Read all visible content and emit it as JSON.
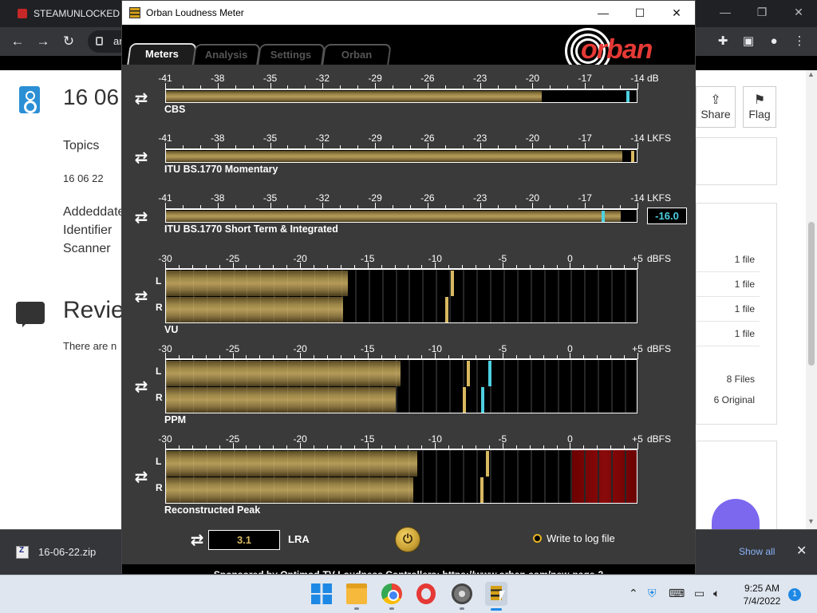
{
  "browser": {
    "tab_title": "STEAMUNLOCKED »",
    "url_fragment": "ar",
    "page": {
      "title": "16 06",
      "topics_label": "Topics",
      "topics_value": "16 06 22",
      "meta_labels": [
        "Addeddate",
        "Identifier",
        "Scanner"
      ],
      "reviews_title": "Revie",
      "reviews_empty": "There are n",
      "share_label": "Share",
      "flag_label": "Flag",
      "file_rows": [
        "1 file",
        "1 file",
        "1 file",
        "1 file"
      ],
      "files_total": "8 Files",
      "files_original": "6 Original"
    },
    "downloads": {
      "file_name": "16-06-22.zip",
      "show_all": "Show all"
    }
  },
  "orban": {
    "window_title": "Orban Loudness Meter",
    "tabs": [
      {
        "label": "Meters",
        "active": true
      },
      {
        "label": "Analysis",
        "active": false
      },
      {
        "label": "Settings",
        "active": false
      },
      {
        "label": "Orban",
        "active": false
      }
    ],
    "logo_text": "orban",
    "meters": [
      {
        "name": "CBS",
        "unit": "dB",
        "scale": [
          "-41",
          "-38",
          "-35",
          "-32",
          "-29",
          "-26",
          "-23",
          "-20",
          "-17",
          "-14"
        ],
        "min": -41,
        "max": -14,
        "channels": [
          {
            "level": -19.5,
            "peak": -14.6,
            "peak_color": "#4dd0e1"
          }
        ]
      },
      {
        "name": "ITU BS.1770 Momentary",
        "unit": "LKFS",
        "scale": [
          "-41",
          "-38",
          "-35",
          "-32",
          "-29",
          "-26",
          "-23",
          "-20",
          "-17",
          "-14"
        ],
        "min": -41,
        "max": -14,
        "channels": [
          {
            "level": -14.9,
            "peak": -14.3,
            "peak_color": "#d8b860"
          }
        ]
      },
      {
        "name": "ITU BS.1770 Short Term & Integrated",
        "unit": "LKFS",
        "scale": [
          "-41",
          "-38",
          "-35",
          "-32",
          "-29",
          "-26",
          "-23",
          "-20",
          "-17",
          "-14"
        ],
        "min": -41,
        "max": -14,
        "channels": [
          {
            "level": -15.0,
            "peak": -16.0,
            "peak_color": "#4dd0e1"
          }
        ],
        "readout": "-16.0"
      },
      {
        "name": "VU",
        "unit": "dBFS",
        "scale": [
          "-30",
          "-25",
          "-20",
          "-15",
          "-10",
          "-5",
          "0",
          "+5"
        ],
        "min": -30,
        "max": 5,
        "labels": [
          "L",
          "R"
        ],
        "channels": [
          {
            "level": -16.5,
            "peak": -8.8,
            "peak_color": "#d8b860"
          },
          {
            "level": -16.9,
            "peak": -9.2,
            "peak_color": "#d8b860"
          }
        ]
      },
      {
        "name": "PPM",
        "unit": "dBFS",
        "scale": [
          "-30",
          "-25",
          "-20",
          "-15",
          "-10",
          "-5",
          "0",
          "+5"
        ],
        "min": -30,
        "max": 5,
        "labels": [
          "L",
          "R"
        ],
        "channels": [
          {
            "level": -12.6,
            "peak": -7.6,
            "peak_color": "#d8b860",
            "peak2": -6.0,
            "peak2_color": "#4dd0e1"
          },
          {
            "level": -13.0,
            "peak": -7.9,
            "peak_color": "#d8b860",
            "peak2": -6.5,
            "peak2_color": "#4dd0e1"
          }
        ]
      },
      {
        "name": "Reconstructed Peak",
        "unit": "dBFS",
        "scale": [
          "-30",
          "-25",
          "-20",
          "-15",
          "-10",
          "-5",
          "0",
          "+5"
        ],
        "min": -30,
        "max": 5,
        "labels": [
          "L",
          "R"
        ],
        "red_from": 0,
        "channels": [
          {
            "level": -11.4,
            "peak": -6.2,
            "peak_color": "#d8b860"
          },
          {
            "level": -11.7,
            "peak": -6.6,
            "peak_color": "#d8b860"
          }
        ]
      }
    ],
    "lra_value": "3.1",
    "lra_label": "LRA",
    "log_label": "Write to log file",
    "sponsor_text": "Sponsored by Optimod-TV Loudness Controllers: https://www.orban.com/new-page-2"
  },
  "taskbar": {
    "time": "9:25 AM",
    "date": "7/4/2022",
    "notifications": "1"
  }
}
